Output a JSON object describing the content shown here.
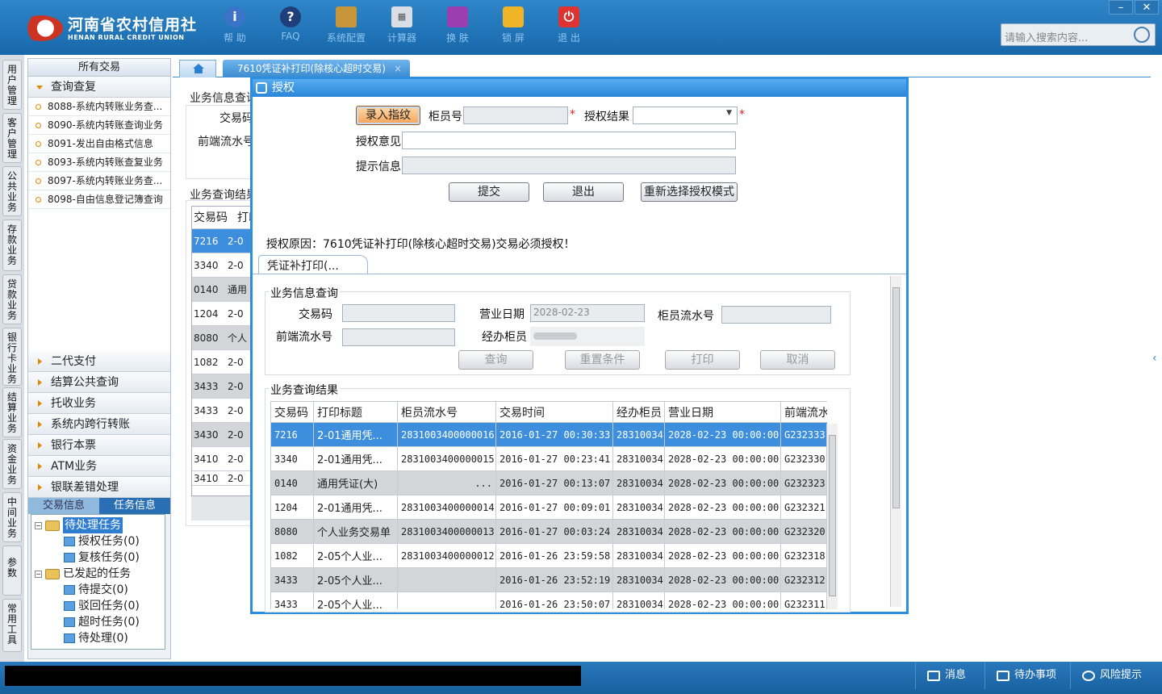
{
  "app": {
    "logo_cn": "河南省农村信用社",
    "logo_en": "HENAN RURAL CREDIT UNION"
  },
  "toolbar": [
    {
      "label": "帮 助",
      "icon": "info-icon"
    },
    {
      "label": "FAQ",
      "icon": "question-icon"
    },
    {
      "label": "系统配置",
      "icon": "toolbox-icon"
    },
    {
      "label": "计算器",
      "icon": "calculator-icon"
    },
    {
      "label": "换 肤",
      "icon": "shirt-icon"
    },
    {
      "label": "锁 屏",
      "icon": "lock-icon"
    },
    {
      "label": "退 出",
      "icon": "power-icon"
    }
  ],
  "search": {
    "placeholder": "请输入搜索内容..."
  },
  "vtabs": [
    "用户管理",
    "客户管理",
    "公共业务",
    "存款业务",
    "贷款业务",
    "银行卡业务",
    "结算业务",
    "资金业务",
    "中间业务",
    "参数",
    "常用工具"
  ],
  "sidebar": {
    "header": "所有交易",
    "open_group": "查询查复",
    "items": [
      "8088-系统内转账业务查...",
      "8090-系统内转账查询业务",
      "8091-发出自由格式信息",
      "8093-系统内转账查复业务",
      "8097-系统内转账业务查...",
      "8098-自由信息登记簿查询"
    ],
    "groups": [
      "二代支付",
      "结算公共查询",
      "托收业务",
      "系统内跨行转账",
      "银行本票",
      "ATM业务",
      "银联差错处理"
    ],
    "subtabs": [
      "交易信息",
      "任务信息"
    ],
    "tree": {
      "pending": "待处理任务",
      "auth": "授权任务(0)",
      "review": "复核任务(0)",
      "initiated": "已发起的任务",
      "to_submit": "待提交(0)",
      "rejected": "驳回任务(0)",
      "timeout": "超时任务(0)",
      "to_process": "待处理(0)"
    }
  },
  "tab": {
    "active": "7610凭证补打印(除核心超时交易)",
    "close": "×"
  },
  "bg": {
    "section1": "业务信息查询",
    "code_lbl": "交易码",
    "flow_lbl": "前端流水号",
    "section2": "业务查询结果",
    "col1": "交易码",
    "col2": "打印",
    "rows": [
      [
        "7216",
        "2-0"
      ],
      [
        "3340",
        "2-0"
      ],
      [
        "0140",
        "通用"
      ],
      [
        "1204",
        "2-0"
      ],
      [
        "8080",
        "个人"
      ],
      [
        "1082",
        "2-0"
      ],
      [
        "3433",
        "2-0"
      ],
      [
        "3433",
        "2-0"
      ],
      [
        "3430",
        "2-0"
      ],
      [
        "3410",
        "2-0"
      ],
      [
        "3410",
        "2-0"
      ]
    ]
  },
  "dialog": {
    "title": "授权",
    "fingerprint": "录入指纹",
    "teller_lbl": "柜员号",
    "result_lbl": "授权结果",
    "opinion_lbl": "授权意见",
    "hint_lbl": "提示信息",
    "submit": "提交",
    "exit": "退出",
    "reselect": "重新选择授权模式",
    "star": "*",
    "reason": "授权原因：7610凭证补打印(除核心超时交易)交易必须授权！",
    "subtab": "凭证补打印(...",
    "form": {
      "section": "业务信息查询",
      "code_lbl": "交易码",
      "date_lbl": "营业日期",
      "date_val": "2028-02-23",
      "tflow_lbl": "柜员流水号",
      "fflow_lbl": "前端流水号",
      "teller_lbl": "经办柜员",
      "query": "查询",
      "reset": "重置条件",
      "print": "打印",
      "cancel": "取消"
    },
    "results": {
      "section": "业务查询结果",
      "headers": [
        "交易码",
        "打印标题",
        "柜员流水号",
        "交易时间",
        "经办柜员",
        "营业日期",
        "前端流水"
      ],
      "rows": [
        [
          "7216",
          "2-01通用凭...",
          "2831003400000016",
          "2016-01-27 00:30:33",
          "28310034",
          "2028-02-23 00:00:00",
          "G232333"
        ],
        [
          "3340",
          "2-01通用凭...",
          "2831003400000015",
          "2016-01-27 00:23:41",
          "28310034",
          "2028-02-23 00:00:00",
          "G232330"
        ],
        [
          "0140",
          "通用凭证(大)",
          "...",
          "2016-01-27 00:13:07",
          "28310034",
          "2028-02-23 00:00:00",
          "G232323"
        ],
        [
          "1204",
          "2-01通用凭...",
          "2831003400000014",
          "2016-01-27 00:09:01",
          "28310034",
          "2028-02-23 00:00:00",
          "G232321"
        ],
        [
          "8080",
          "个人业务交易单",
          "2831003400000013",
          "2016-01-27 00:03:24",
          "28310034",
          "2028-02-23 00:00:00",
          "G232320"
        ],
        [
          "1082",
          "2-05个人业...",
          "2831003400000012",
          "2016-01-26 23:59:58",
          "28310034",
          "2028-02-23 00:00:00",
          "G232318"
        ],
        [
          "3433",
          "2-05个人业...",
          "",
          "2016-01-26 23:52:19",
          "28310034",
          "2028-02-23 00:00:00",
          "G232312"
        ],
        [
          "3433",
          "2-05个人业...",
          "",
          "2016-01-26 23:50:07",
          "28310034",
          "2028-02-23 00:00:00",
          "G232311"
        ]
      ]
    }
  },
  "status": {
    "msg": "消息",
    "todo": "待办事项",
    "risk": "风险提示"
  }
}
